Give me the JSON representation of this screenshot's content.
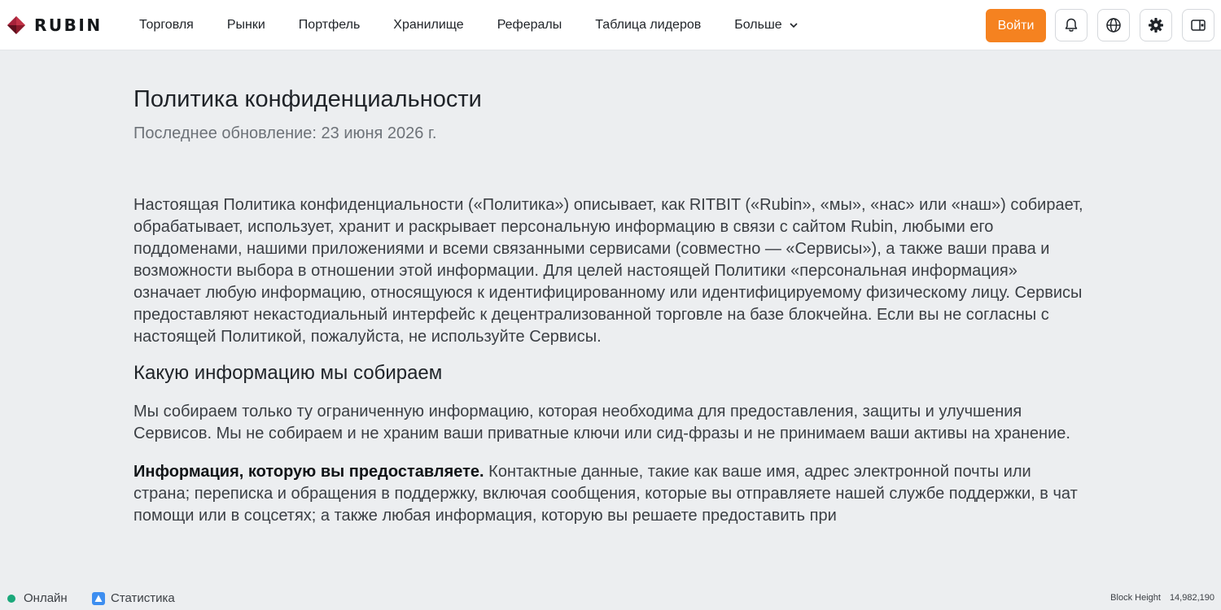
{
  "header": {
    "logo_text": "RUBIN",
    "nav": [
      {
        "label": "Торговля"
      },
      {
        "label": "Рынки"
      },
      {
        "label": "Портфель"
      },
      {
        "label": "Хранилище"
      },
      {
        "label": "Рефералы"
      },
      {
        "label": "Таблица лидеров"
      },
      {
        "label": "Больше"
      }
    ],
    "login_label": "Войти",
    "icons": [
      "bell-icon",
      "globe-icon",
      "gear-icon",
      "wallet-icon"
    ],
    "accent_color": "#f58220"
  },
  "policy": {
    "title": "Политика конфиденциальности",
    "updated": "Последнее обновление: 23 июня 2026 г.",
    "intro": "Настоящая Политика конфиденциальности («Политика») описывает, как RITBIT («Rubin», «мы», «нас» или «наш») собирает, обрабатывает, использует, хранит и раскрывает персональную информацию в связи с сайтом Rubin, любыми его поддоменами, нашими приложениями и всеми связанными сервисами (совместно — «Сервисы»), а также ваши права и возможности выбора в отношении этой информации. Для целей настоящей Политики «персональная информация» означает любую информацию, относящуюся к идентифицированному или идентифицируемому физическому лицу. Сервисы предоставляют некастодиальный интерфейс к децентрализованной торговле на базе блокчейна. Если вы не согласны с настоящей Политикой, пожалуйста, не используйте Сервисы.",
    "section_heading": "Какую информацию мы собираем",
    "section_para": "Мы собираем только ту ограниченную информацию, которая необходима для предоставления, защиты и улучшения Сервисов. Мы не собираем и не храним ваши приватные ключи или сид-фразы и не принимаем ваши активы на хранение.",
    "provided_bold": "Информация, которую вы предоставляете.",
    "provided_text": " Контактные данные, такие как ваше имя, адрес электронной почты или страна; переписка и обращения в поддержку, включая сообщения, которые вы отправляете нашей службе поддержки, в чат помощи или в соцсетях; а также любая информация, которую вы решаете предоставить при"
  },
  "footer": {
    "status": "Онлайн",
    "status_color": "#1aa87a",
    "stats": "Статистика",
    "block_height_label": "Block Height",
    "block_height_value": "14,982,190"
  }
}
